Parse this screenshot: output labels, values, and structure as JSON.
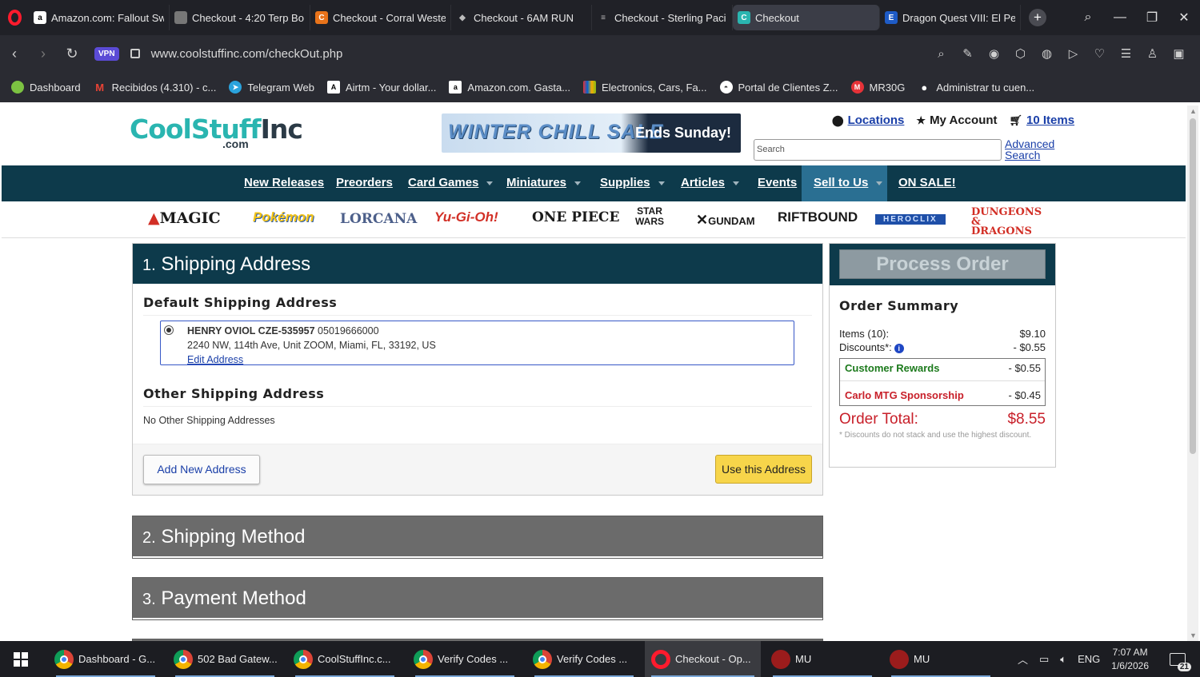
{
  "tabs": [
    {
      "title": "Amazon.com: Fallout Sw",
      "icon": "amazon-icon",
      "color": "#ffffff"
    },
    {
      "title": "Checkout - 4:20 Terp Bo",
      "icon": "store-icon",
      "color": "#777777"
    },
    {
      "title": "Checkout - Corral Weste",
      "icon": "corral-icon",
      "color": "#e8731a"
    },
    {
      "title": "Checkout - 6AM RUN",
      "icon": "shield-icon",
      "color": "#999999"
    },
    {
      "title": "Checkout - Sterling Paci",
      "icon": "doc-icon",
      "color": "#999999"
    },
    {
      "title": "Checkout",
      "icon": "coolstuff-icon",
      "color": "#2ab5b0",
      "active": true
    },
    {
      "title": "Dragon Quest VIII: El Pe",
      "icon": "e-icon",
      "color": "#1e5bc6"
    }
  ],
  "address_bar": {
    "vpn_label": "VPN",
    "url": "www.coolstuffinc.com/checkOut.php"
  },
  "bookmarks": [
    {
      "label": "Dashboard",
      "color": "#7cc242"
    },
    {
      "label": "Recibidos (4.310) - c...",
      "color": "#ea4335"
    },
    {
      "label": "Telegram Web",
      "color": "#2aa3dd"
    },
    {
      "label": "Airtm - Your dollar...",
      "color": "#ffffff"
    },
    {
      "label": "Amazon.com. Gasta...",
      "color": "#ffffff"
    },
    {
      "label": "Electronics, Cars, Fa...",
      "color": "#e53238"
    },
    {
      "label": "Portal de Clientes Z...",
      "color": "#ffffff"
    },
    {
      "label": "MR30G",
      "color": "#e53238"
    },
    {
      "label": "Administrar tu cuen...",
      "color": "#ffffff"
    }
  ],
  "site": {
    "logo_main": "CoolStuff",
    "logo_inc": "Inc",
    "logo_sub": ".com",
    "banner_text": "WINTER CHILL SALE",
    "banner_cta": "Ends Sunday!",
    "locations": "Locations",
    "my_account": "My Account",
    "cart": "10 Items",
    "search_placeholder": "Search",
    "advanced": "Advanced",
    "search_word": "Search"
  },
  "nav": [
    {
      "label": "New Releases",
      "caret": false
    },
    {
      "label": "Preorders",
      "caret": false
    },
    {
      "label": "Card Games",
      "caret": true
    },
    {
      "label": "Miniatures",
      "caret": true
    },
    {
      "label": "Supplies",
      "caret": true
    },
    {
      "label": "Articles",
      "caret": true
    },
    {
      "label": "Events",
      "caret": false
    },
    {
      "label": "Sell to Us",
      "caret": true
    },
    {
      "label": "ON SALE!",
      "caret": false
    }
  ],
  "brands": [
    {
      "label": "MAGIC",
      "color": "#1a1a1a"
    },
    {
      "label": "Pokémon",
      "color": "#f3c316"
    },
    {
      "label": "LORCANA",
      "color": "#4c5f8a"
    },
    {
      "label": "Yu-Gi-Oh!",
      "color": "#d22f26"
    },
    {
      "label": "ONE PIECE",
      "color": "#1a1a1a"
    },
    {
      "label": "STAR WARS",
      "color": "#1a1a1a"
    },
    {
      "label": "GUNDAM",
      "color": "#1a1a1a"
    },
    {
      "label": "RIFTBOUND",
      "color": "#1a1a1a"
    },
    {
      "label": "HEROCLIX",
      "color": "#1e4fa8"
    },
    {
      "label": "DUNGEONS & DRAGONS",
      "color": "#d22f26"
    }
  ],
  "shipping": {
    "number": "1.",
    "title": "Shipping Address",
    "default_heading": "Default Shipping Address",
    "name": "HENRY OVIOL CZE-535957",
    "phone": "05019666000",
    "address": "2240 NW, 114th Ave, Unit ZOOM, Miami, FL, 33192, US",
    "edit_label": "Edit Address",
    "other_heading": "Other Shipping Address",
    "no_other": "No Other Shipping Addresses",
    "add_label": "Add New Address",
    "use_label": "Use this Address"
  },
  "method": {
    "number": "2.",
    "title": "Shipping Method"
  },
  "payment": {
    "number": "3.",
    "title": "Payment Method"
  },
  "summary": {
    "process_label": "Process Order",
    "title": "Order Summary",
    "items_label": "Items (10):",
    "items_value": "$9.10",
    "discounts_label": "Discounts*:",
    "discounts_value": "- $0.55",
    "reward1_label": "Customer Rewards",
    "reward1_value": "- $0.55",
    "reward2_label": "Carlo MTG Sponsorship",
    "reward2_value": "- $0.45",
    "total_label": "Order Total:",
    "total_value": "$8.55",
    "fine_print": "* Discounts do not stack and use the highest discount."
  },
  "taskbar": {
    "apps": [
      {
        "label": "Dashboard - G...",
        "icon": "chrome-icon"
      },
      {
        "label": "502 Bad Gatew...",
        "icon": "chrome-icon"
      },
      {
        "label": "CoolStuffInc.c...",
        "icon": "chrome-icon"
      },
      {
        "label": "Verify Codes ...",
        "icon": "chrome-icon"
      },
      {
        "label": "Verify Codes ...",
        "icon": "chrome-icon"
      },
      {
        "label": "Checkout - Op...",
        "icon": "opera-icon"
      },
      {
        "label": "MU",
        "icon": "mu-icon"
      },
      {
        "label": "MU",
        "icon": "mu-icon"
      }
    ],
    "lang": "ENG",
    "time": "7:07 AM",
    "date": "1/6/2026",
    "notifications": "21"
  }
}
